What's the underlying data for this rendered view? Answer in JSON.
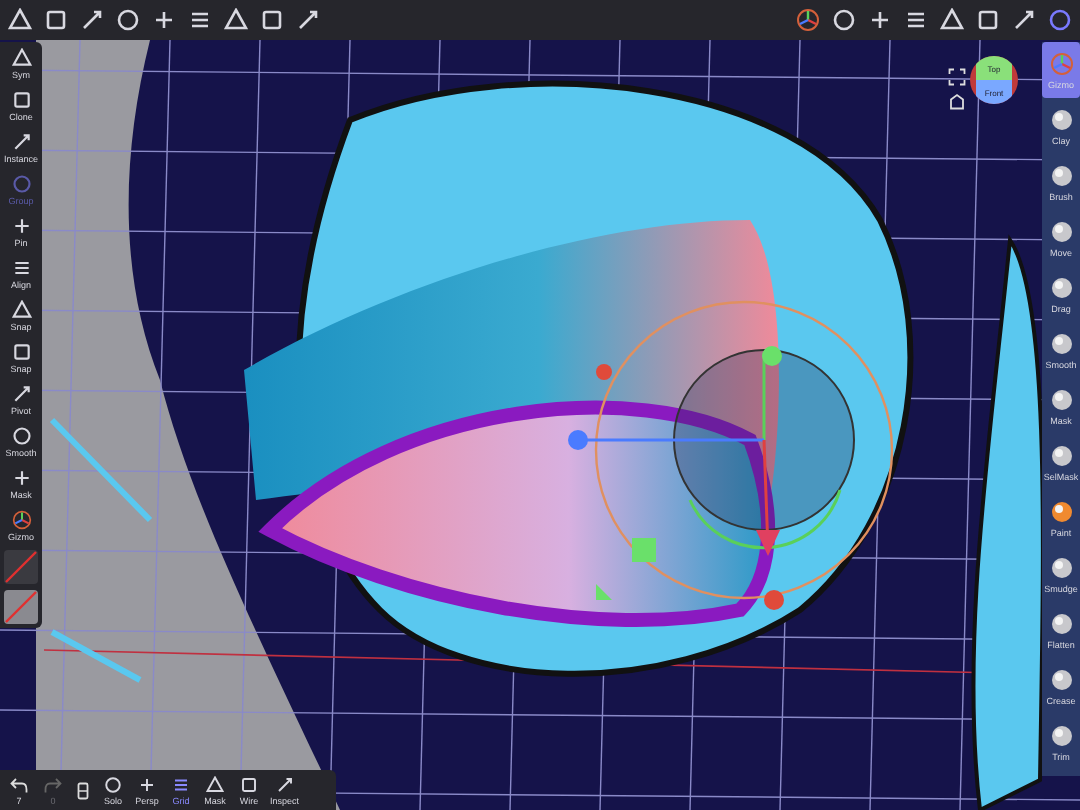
{
  "left_toolbar": [
    {
      "label": "Sym",
      "disabled": false
    },
    {
      "label": "Clone",
      "disabled": false
    },
    {
      "label": "Instance",
      "disabled": false
    },
    {
      "label": "Group",
      "disabled": true
    },
    {
      "label": "Pin",
      "disabled": false
    },
    {
      "label": "Align",
      "disabled": false
    },
    {
      "label": "Snap",
      "disabled": false
    },
    {
      "label": "Snap",
      "disabled": false
    },
    {
      "label": "Pivot",
      "disabled": false
    },
    {
      "label": "Smooth",
      "disabled": false
    },
    {
      "label": "Mask",
      "disabled": false
    },
    {
      "label": "Gizmo",
      "disabled": false
    }
  ],
  "nav_cube": {
    "top": "Top",
    "front": "Front"
  },
  "right_toolbar": [
    {
      "label": "Gizmo",
      "selected": true
    },
    {
      "label": "Clay",
      "selected": false
    },
    {
      "label": "Brush",
      "selected": false
    },
    {
      "label": "Move",
      "selected": false
    },
    {
      "label": "Drag",
      "selected": false
    },
    {
      "label": "Smooth",
      "selected": false
    },
    {
      "label": "Mask",
      "selected": false
    },
    {
      "label": "SelMask",
      "selected": false
    },
    {
      "label": "Paint",
      "selected": false
    },
    {
      "label": "Smudge",
      "selected": false
    },
    {
      "label": "Flatten",
      "selected": false
    },
    {
      "label": "Crease",
      "selected": false
    },
    {
      "label": "Trim",
      "selected": false
    }
  ],
  "history": {
    "undo_count": "7",
    "redo_count": "0"
  },
  "bottom_toolbar": [
    {
      "label": "Solo",
      "selected": false
    },
    {
      "label": "Persp",
      "selected": false
    },
    {
      "label": "Grid",
      "selected": true
    },
    {
      "label": "Mask",
      "selected": false
    },
    {
      "label": "Wire",
      "selected": false
    },
    {
      "label": "Inspect",
      "selected": false
    }
  ]
}
